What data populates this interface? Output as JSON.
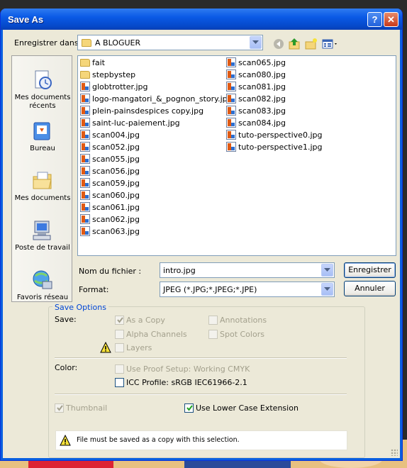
{
  "window": {
    "title": "Save As",
    "help_label": "?",
    "close_label": "✕"
  },
  "save_in": {
    "label": "Enregistrer dans :",
    "value": "A BLOGUER"
  },
  "places": [
    {
      "label": "Mes documents récents",
      "icon": "recent-documents-icon"
    },
    {
      "label": "Bureau",
      "icon": "desktop-icon"
    },
    {
      "label": "Mes documents",
      "icon": "my-documents-icon"
    },
    {
      "label": "Poste de travail",
      "icon": "my-computer-icon"
    },
    {
      "label": "Favoris réseau",
      "icon": "network-places-icon"
    }
  ],
  "files_col1": [
    {
      "name": "fait",
      "type": "folder"
    },
    {
      "name": "stepbystep",
      "type": "folder"
    },
    {
      "name": "globtrotter.jpg",
      "type": "jpg"
    },
    {
      "name": "logo-mangatori_&_pognon_story.jpg",
      "type": "jpg"
    },
    {
      "name": "plein-painsdespices copy.jpg",
      "type": "jpg"
    },
    {
      "name": "saint-luc-paiement.jpg",
      "type": "jpg"
    },
    {
      "name": "scan004.jpg",
      "type": "jpg"
    },
    {
      "name": "scan052.jpg",
      "type": "jpg"
    },
    {
      "name": "scan055.jpg",
      "type": "jpg"
    },
    {
      "name": "scan056.jpg",
      "type": "jpg"
    },
    {
      "name": "scan059.jpg",
      "type": "jpg"
    },
    {
      "name": "scan060.jpg",
      "type": "jpg"
    },
    {
      "name": "scan061.jpg",
      "type": "jpg"
    },
    {
      "name": "scan062.jpg",
      "type": "jpg"
    },
    {
      "name": "scan063.jpg",
      "type": "jpg"
    }
  ],
  "files_col2": [
    {
      "name": "scan065.jpg",
      "type": "jpg"
    },
    {
      "name": "scan080.jpg",
      "type": "jpg"
    },
    {
      "name": "scan081.jpg",
      "type": "jpg"
    },
    {
      "name": "scan082.jpg",
      "type": "jpg"
    },
    {
      "name": "scan083.jpg",
      "type": "jpg"
    },
    {
      "name": "scan084.jpg",
      "type": "jpg"
    },
    {
      "name": "tuto-perspective0.jpg",
      "type": "jpg"
    },
    {
      "name": "tuto-perspective1.jpg",
      "type": "jpg"
    }
  ],
  "filename": {
    "label": "Nom du fichier :",
    "value": "intro.jpg"
  },
  "format": {
    "label": "Format:",
    "value": "JPEG (*.JPG;*.JPEG;*.JPE)"
  },
  "buttons": {
    "save": "Enregistrer",
    "cancel": "Annuler"
  },
  "save_options": {
    "title": "Save Options",
    "save_label": "Save:",
    "as_a_copy": "As a Copy",
    "alpha_channels": "Alpha Channels",
    "layers": "Layers",
    "annotations": "Annotations",
    "spot_colors": "Spot Colors",
    "color_label": "Color:",
    "use_proof_setup": "Use Proof Setup:  Working CMYK",
    "icc_profile": "ICC Profile:  sRGB IEC61966-2.1",
    "thumbnail": "Thumbnail",
    "lowercase_ext": "Use Lower Case Extension",
    "warning_text": "File must be saved as a copy with this selection."
  },
  "state": {
    "as_a_copy": true,
    "alpha_channels": false,
    "layers": false,
    "annotations": false,
    "spot_colors": false,
    "use_proof_setup": false,
    "icc_profile": false,
    "thumbnail": true,
    "lowercase_ext": true
  },
  "colors": {
    "title_bar": "#0a5ae6",
    "group_title": "#0046d5",
    "dialog_bg": "#ece9d8"
  }
}
